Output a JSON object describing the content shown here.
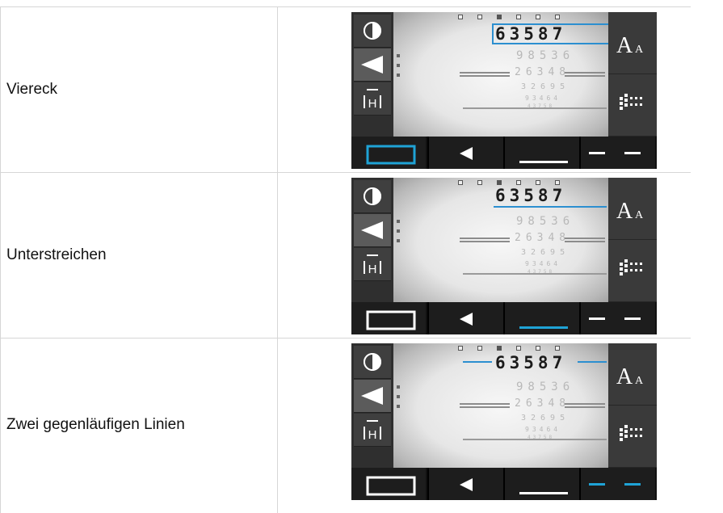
{
  "rows": [
    {
      "label": "Viereck",
      "mode": "viereck"
    },
    {
      "label": "Unterstreichen",
      "mode": "unterstreichen"
    },
    {
      "label": "Zwei gegenläufigen Linien",
      "mode": "zwei-linien"
    }
  ],
  "chart": {
    "main_line": "63587",
    "line2": "98536",
    "line3": "26348",
    "line4": "32695",
    "line5": "93464",
    "line6": "43758"
  },
  "colors": {
    "accent": "#1fa3d6",
    "frame_blue": "#2c8fd0",
    "dark_panel": "#2f2f2f",
    "bottom_bar": "#111111"
  },
  "icons": [
    "contrast-icon",
    "left-arrow-icon",
    "hyperopia-icon",
    "font-size-icon",
    "grid-icon",
    "rectangle-mode-icon",
    "left-triangle-icon",
    "underline-icon",
    "two-lines-icon"
  ],
  "font_label": {
    "big": "A",
    "small": "A"
  }
}
